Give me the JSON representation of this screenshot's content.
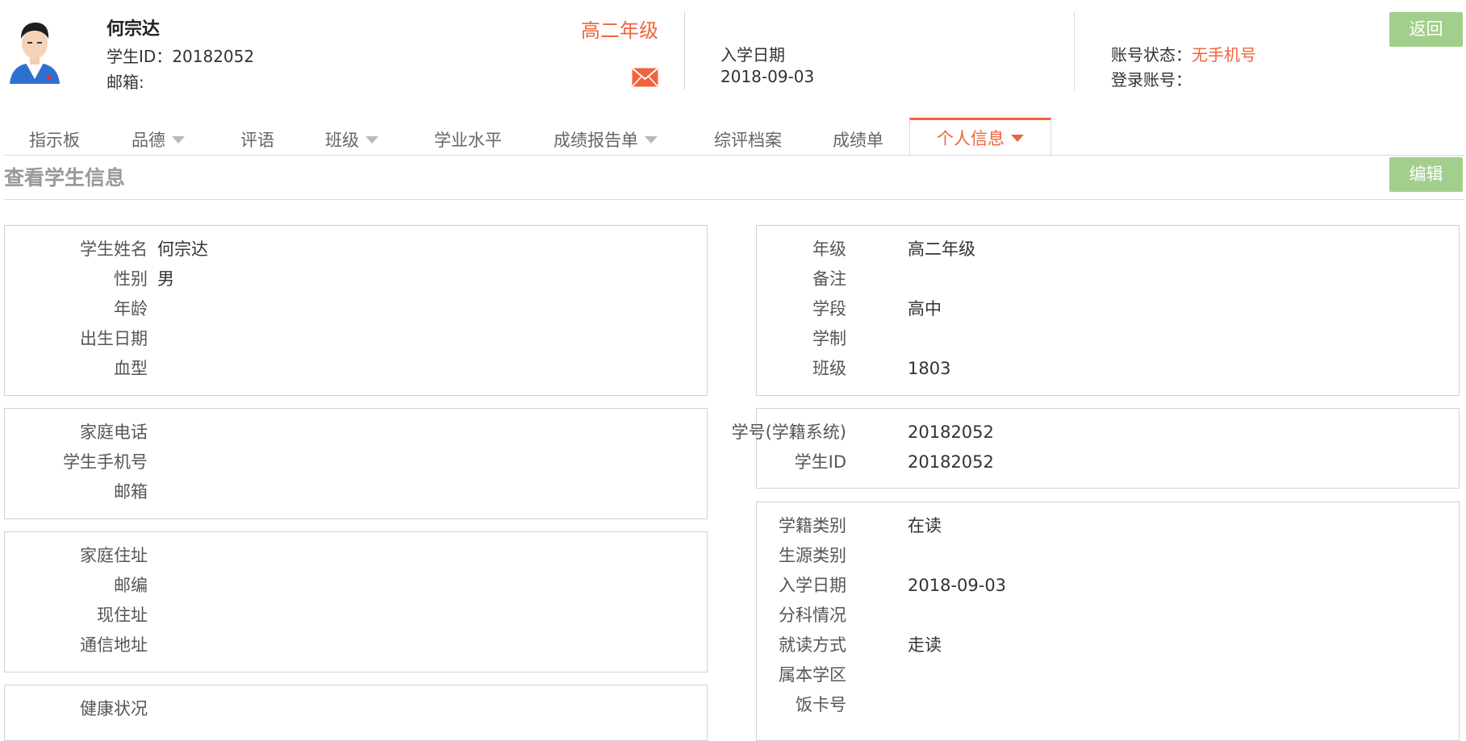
{
  "header": {
    "name": "何宗达",
    "student_id_label": "学生ID：",
    "student_id_value": "20182052",
    "email_label": "邮箱:",
    "grade": "高二年级",
    "enroll_label": "入学日期",
    "enroll_date": "2018-09-03",
    "account_status_label": "账号状态：",
    "account_status_value": "无手机号",
    "login_account_label": "登录账号：",
    "back_button": "返回",
    "icons": {
      "avatar": "student-photo",
      "mail": "mail-icon"
    }
  },
  "tabs": [
    {
      "label": "指示板",
      "dropdown": false
    },
    {
      "label": "品德",
      "dropdown": true
    },
    {
      "label": "评语",
      "dropdown": false
    },
    {
      "label": "班级",
      "dropdown": true
    },
    {
      "label": "学业水平",
      "dropdown": false
    },
    {
      "label": "成绩报告单",
      "dropdown": true
    },
    {
      "label": "综评档案",
      "dropdown": false
    },
    {
      "label": "成绩单",
      "dropdown": false
    },
    {
      "label": "个人信息",
      "dropdown": true,
      "active": true
    }
  ],
  "section": {
    "title": "查看学生信息",
    "edit_button": "编辑"
  },
  "left_panels": [
    {
      "fields": [
        {
          "label": "学生姓名",
          "value": "何宗达"
        },
        {
          "label": "性别",
          "value": "男"
        },
        {
          "label": "年龄",
          "value": ""
        },
        {
          "label": "出生日期",
          "value": ""
        },
        {
          "label": "血型",
          "value": ""
        }
      ]
    },
    {
      "fields": [
        {
          "label": "家庭电话",
          "value": ""
        },
        {
          "label": "学生手机号",
          "value": ""
        },
        {
          "label": "邮箱",
          "value": ""
        }
      ]
    },
    {
      "fields": [
        {
          "label": "家庭住址",
          "value": ""
        },
        {
          "label": "邮编",
          "value": ""
        },
        {
          "label": "现住址",
          "value": ""
        },
        {
          "label": "通信地址",
          "value": ""
        }
      ]
    },
    {
      "fields": [
        {
          "label": "健康状况",
          "value": ""
        }
      ]
    }
  ],
  "right_panels": [
    {
      "fields": [
        {
          "label": "年级",
          "value": "高二年级"
        },
        {
          "label": "备注",
          "value": ""
        },
        {
          "label": "学段",
          "value": "高中"
        },
        {
          "label": "学制",
          "value": ""
        },
        {
          "label": "班级",
          "value": "1803"
        }
      ]
    },
    {
      "fields": [
        {
          "label": "学号(学籍系统)",
          "value": "20182052"
        },
        {
          "label": "学生ID",
          "value": "20182052"
        }
      ]
    },
    {
      "fields": [
        {
          "label": "学籍类别",
          "value": "在读"
        },
        {
          "label": "生源类别",
          "value": ""
        },
        {
          "label": "入学日期",
          "value": "2018-09-03"
        },
        {
          "label": "分科情况",
          "value": ""
        },
        {
          "label": "就读方式",
          "value": "走读"
        },
        {
          "label": "属本学区",
          "value": ""
        },
        {
          "label": "饭卡号",
          "value": ""
        }
      ]
    }
  ],
  "colors": {
    "accent": "#f0643c",
    "button_green": "#a3cf8c",
    "border": "#d2d2d2",
    "section_title": "#999999"
  }
}
